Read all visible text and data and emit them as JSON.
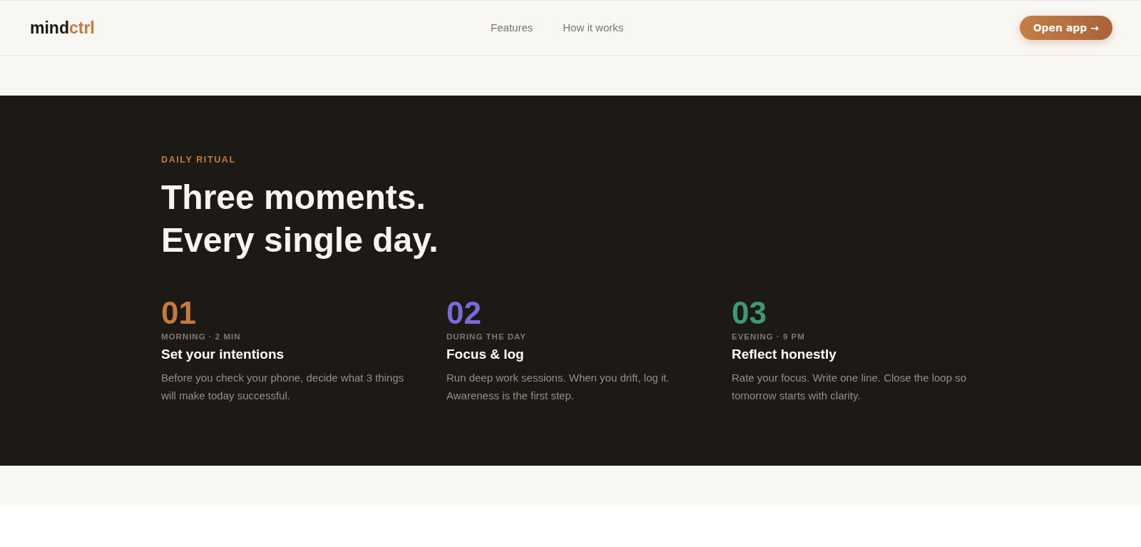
{
  "header": {
    "logo": {
      "main": "mind",
      "accent": "ctrl"
    },
    "nav": [
      {
        "label": "Features"
      },
      {
        "label": "How it works"
      }
    ],
    "cta": {
      "label": "Open app →"
    }
  },
  "ritual": {
    "eyebrow": "DAILY RITUAL",
    "heading": [
      "Three moments.",
      "Every single day."
    ],
    "steps": [
      {
        "number": "01",
        "color": "#c47a3e",
        "meta": "MORNING · 2 MIN",
        "title": "Set your intentions",
        "description": "Before you check your phone, decide what 3 things will make today successful."
      },
      {
        "number": "02",
        "color": "#7b68dc",
        "meta": "DURING THE DAY",
        "title": "Focus & log",
        "description": "Run deep work sessions. When you drift, log it. Awareness is the first step."
      },
      {
        "number": "03",
        "color": "#3f9a72",
        "meta": "EVENING · 9 PM",
        "title": "Reflect honestly",
        "description": "Rate your focus. Write one line. Close the loop so tomorrow starts with clarity."
      }
    ]
  }
}
